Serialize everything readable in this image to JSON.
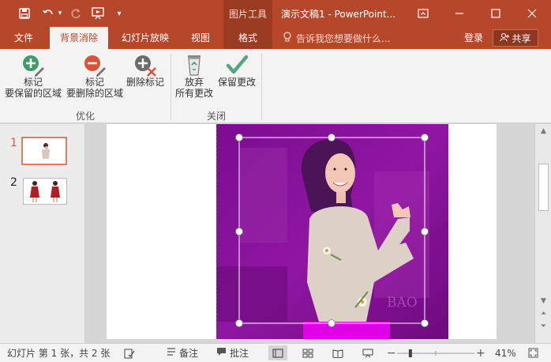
{
  "titlebar": {
    "context_group": "图片工具",
    "document_title": "演示文稿1 - PowerPoint...",
    "icons": [
      "save-icon",
      "undo-icon",
      "redo-icon",
      "slideshow-from-start-icon",
      "customize-qat-icon",
      "ribbon-display-icon",
      "minimize-icon",
      "maximize-icon",
      "close-icon"
    ]
  },
  "tabs": {
    "file": "文件",
    "background_removal": "背景消除",
    "slideshow": "幻灯片放映",
    "view": "视图",
    "format": "格式",
    "tell_me": "告诉我您想要做什么...",
    "login": "登录",
    "share": "共享"
  },
  "ribbon": {
    "refine_group": {
      "label": "优化",
      "mark_keep": {
        "line1": "标记",
        "line2": "要保留的区域"
      },
      "mark_remove": {
        "line1": "标记",
        "line2": "要删除的区域"
      },
      "delete_mark": {
        "line1": "删除标记"
      }
    },
    "close_group": {
      "label": "关闭",
      "discard": {
        "line1": "放弃",
        "line2": "所有更改"
      },
      "keep": {
        "line1": "保留更改"
      }
    },
    "colors": {
      "plus_green": "#3f9c6a",
      "minus_red": "#d9533c",
      "check_green": "#58a585"
    }
  },
  "thumbnails": {
    "items": [
      {
        "number": "1",
        "selected": true
      },
      {
        "number": "2",
        "selected": false
      }
    ],
    "selected_border": "#e07b5f"
  },
  "canvas": {
    "watermark_text": "BAO",
    "removal_overlay_color": "#8a0f9a"
  },
  "statusbar": {
    "slide_info": "幻灯片 第 1 张，共 2 张",
    "notes": "备注",
    "comments": "批注",
    "zoom": "41%",
    "zoom_level": 0.41
  }
}
